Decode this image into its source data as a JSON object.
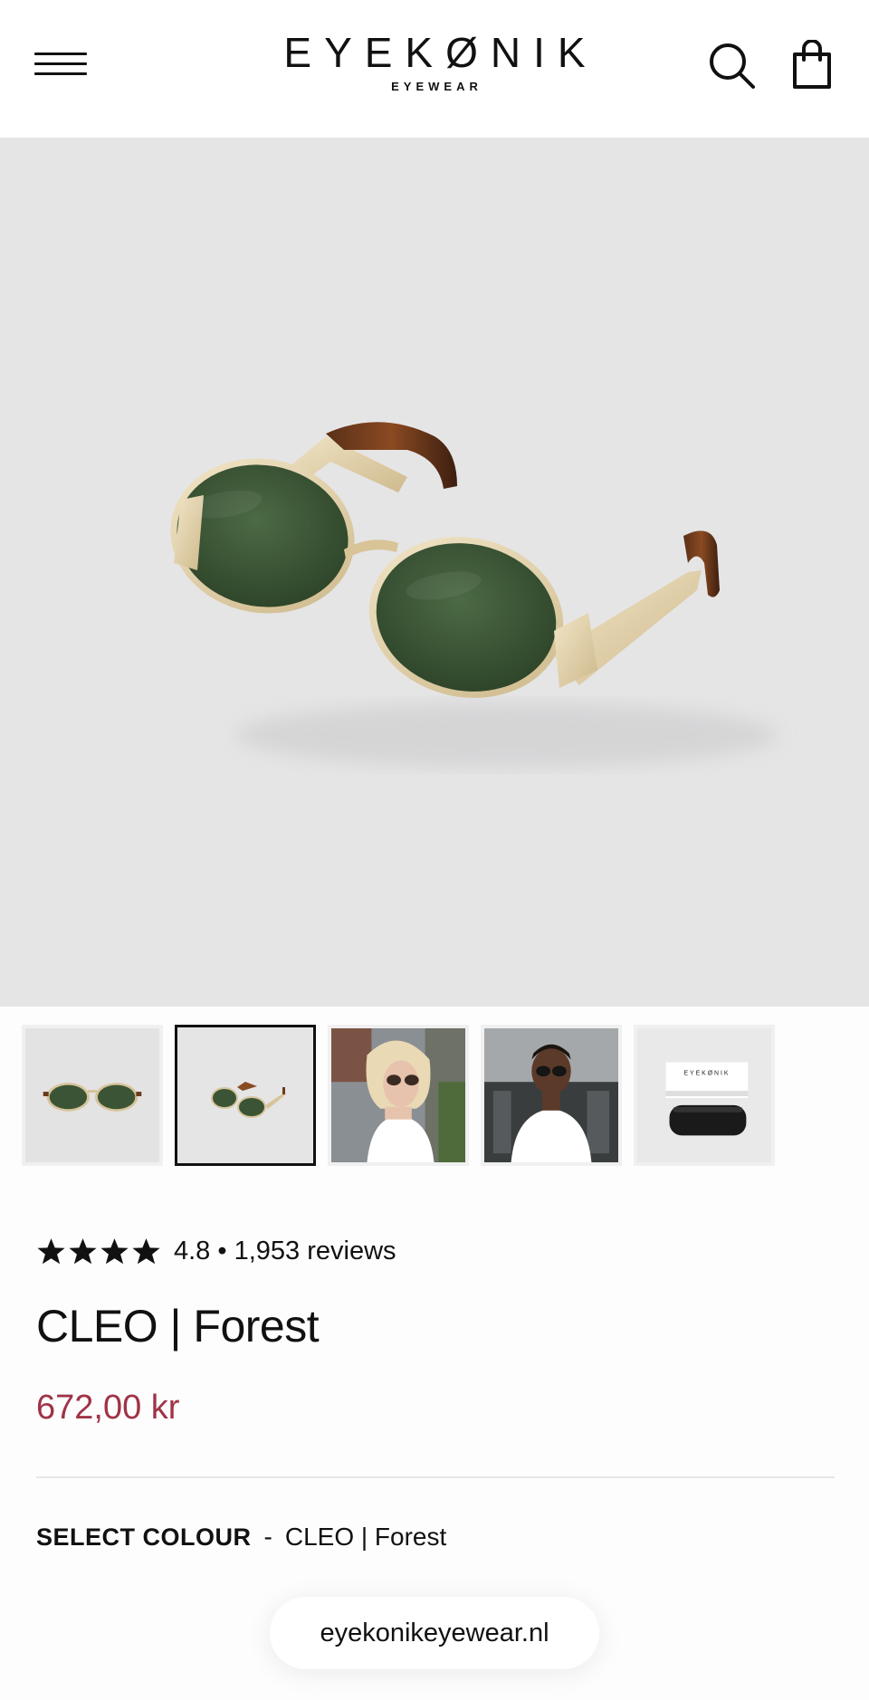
{
  "header": {
    "logo_main": "EYEKØNIK",
    "logo_sub": "EYEWEAR"
  },
  "icons": {
    "menu": "hamburger-menu-icon",
    "search": "search-icon",
    "cart": "shopping-bag-icon"
  },
  "gallery": {
    "thumbnails": [
      {
        "name": "front-view",
        "active": false
      },
      {
        "name": "angle-view",
        "active": true
      },
      {
        "name": "model-woman",
        "active": false
      },
      {
        "name": "model-man",
        "active": false
      },
      {
        "name": "case-and-box",
        "active": false
      }
    ],
    "box_logo": "EYEKØNIK"
  },
  "product": {
    "rating": "4.8",
    "rating_stars": 4,
    "reviews_text": "4.8 • 1,953 reviews",
    "title": "CLEO | Forest",
    "price": "672,00 kr"
  },
  "colour": {
    "label": "SELECT COLOUR",
    "separator": "-",
    "value": "CLEO | Forest"
  },
  "browser": {
    "url": "eyekonikeyewear.nl"
  },
  "colors": {
    "price": "#a03347",
    "lens": "#3f5a3a",
    "frame": "#e6d3a8",
    "hero_bg": "#e5e5e6"
  }
}
